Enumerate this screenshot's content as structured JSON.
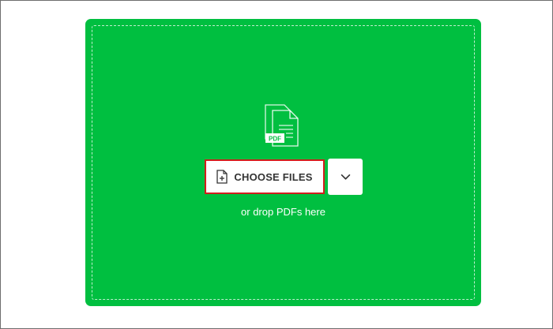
{
  "upload": {
    "choose_label": "CHOOSE FILES",
    "drop_text": "or drop PDFs here",
    "pdf_badge": "PDF"
  },
  "icons": {
    "document": "pdf-document-icon",
    "add_file": "add-file-icon",
    "dropdown": "chevron-down-icon"
  },
  "colors": {
    "drop_zone": "#00bf40",
    "highlight": "#d31c1c",
    "button_bg": "#ffffff",
    "button_text": "#333333"
  }
}
